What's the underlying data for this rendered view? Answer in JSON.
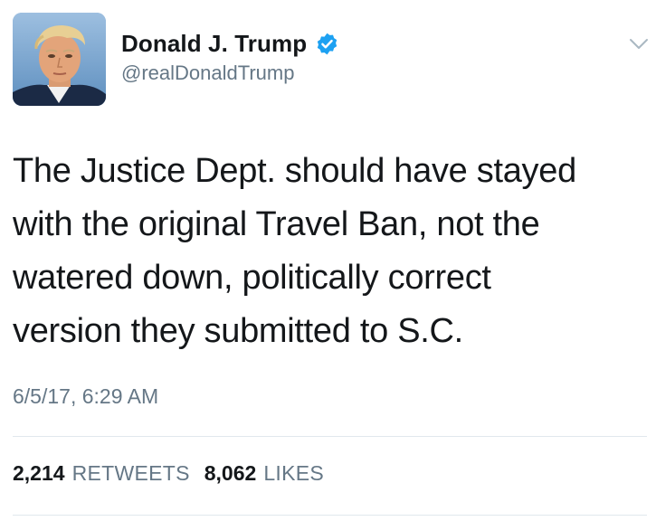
{
  "user": {
    "display_name": "Donald J. Trump",
    "handle": "@realDonaldTrump",
    "verified": true,
    "avatar_icon": "profile-photo"
  },
  "tweet": {
    "lines": [
      "The Justice Dept. should have stayed",
      "with the original Travel Ban, not the",
      "watered down, politically correct",
      "version they submitted to S.C."
    ],
    "timestamp": "6/5/17, 6:29 AM"
  },
  "stats": {
    "retweets_count": "2,214",
    "retweets_label": "RETWEETS",
    "likes_count": "8,062",
    "likes_label": "LIKES"
  },
  "icons": {
    "verified": "verified-badge-icon",
    "menu": "chevron-down-icon"
  },
  "colors": {
    "verified_blue": "#1da1f2",
    "secondary_text": "#657786",
    "primary_text": "#14171a",
    "divider": "#e1e8ed"
  }
}
